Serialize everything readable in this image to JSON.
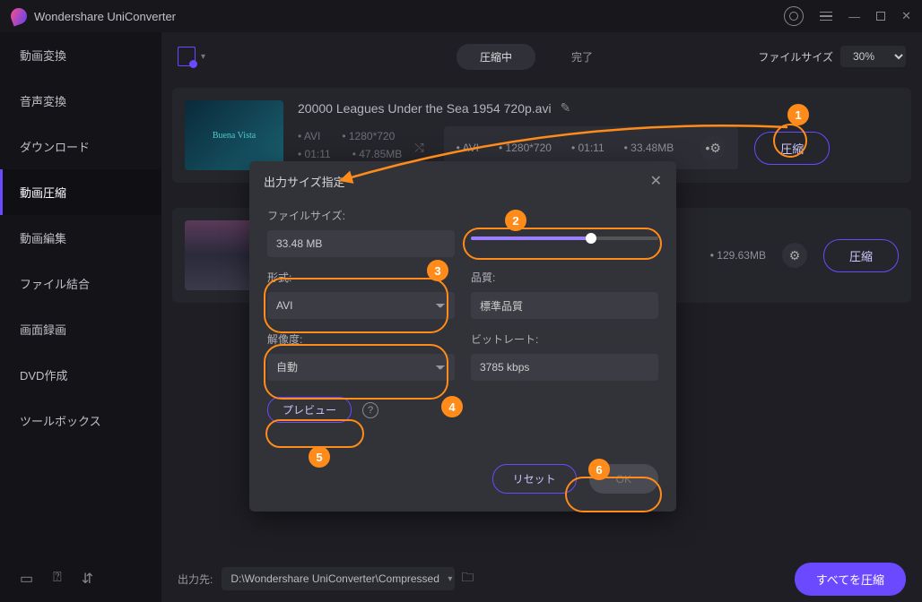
{
  "app": {
    "title": "Wondershare UniConverter"
  },
  "sidebar": {
    "items": [
      {
        "label": "動画変換"
      },
      {
        "label": "音声変換"
      },
      {
        "label": "ダウンロード"
      },
      {
        "label": "動画圧縮"
      },
      {
        "label": "動画編集"
      },
      {
        "label": "ファイル結合"
      },
      {
        "label": "画面録画"
      },
      {
        "label": "DVD作成"
      },
      {
        "label": "ツールボックス"
      }
    ]
  },
  "toolbar": {
    "tab_active": "圧縮中",
    "tab_done": "完了",
    "filesize_label": "ファイルサイズ",
    "size_select": "30%"
  },
  "files": [
    {
      "name": "20000 Leagues Under the Sea 1954 720p.avi",
      "src": {
        "format": "AVI",
        "res": "1280*720",
        "dur": "01:11",
        "size": "47.85MB"
      },
      "out": {
        "format": "AVI",
        "res": "1280*720",
        "dur": "01:11",
        "size": "33.48MB"
      },
      "compress_btn": "圧縮"
    },
    {
      "out": {
        "size": "129.63MB"
      },
      "compress_btn": "圧縮"
    }
  ],
  "modal": {
    "title": "出力サイズ指定",
    "filesize_label": "ファイルサイズ:",
    "filesize_value": "33.48 MB",
    "format_label": "形式:",
    "format_value": "AVI",
    "quality_label": "品質:",
    "quality_value": "標準品質",
    "resolution_label": "解像度:",
    "resolution_value": "自動",
    "bitrate_label": "ビットレート:",
    "bitrate_value": "3785 kbps",
    "preview_btn": "プレビュー",
    "reset_btn": "リセット",
    "ok_btn": "OK"
  },
  "bottom": {
    "output_label": "出力先:",
    "output_path": "D:\\Wondershare UniConverter\\Compressed",
    "compress_all": "すべてを圧縮"
  },
  "annotations": {
    "a1": "1",
    "a2": "2",
    "a3": "3",
    "a4": "4",
    "a5": "5",
    "a6": "6"
  }
}
